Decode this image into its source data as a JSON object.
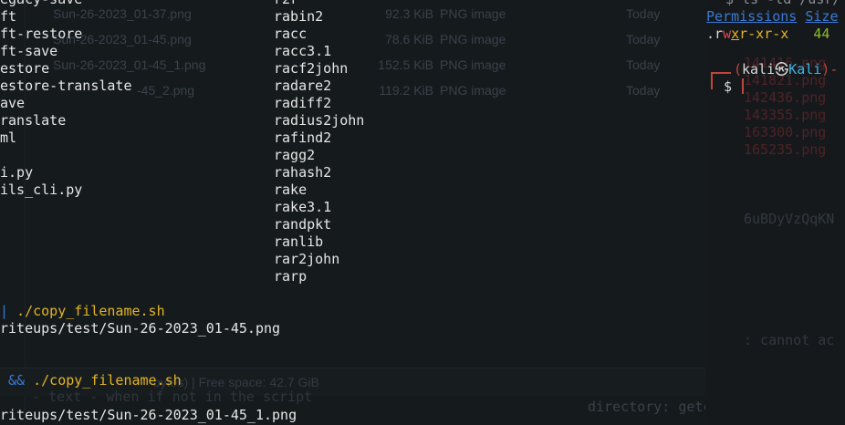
{
  "file_manager": {
    "rows": [
      {
        "name": "Sun-26-2023_01-37.png",
        "size": "92.3 KiB",
        "type": "PNG image",
        "date": "Today"
      },
      {
        "name": "Sun-26-2023_01-45.png",
        "size": "78.6 KiB",
        "type": "PNG image",
        "date": "Today"
      },
      {
        "name": "Sun-26-2023_01-45_1.png",
        "size": "152.5 KiB",
        "type": "PNG image",
        "date": "Today"
      },
      {
        "name": "-45_2.png",
        "size": "119.2 KiB",
        "type": "PNG image",
        "date": "Today"
      }
    ],
    "status": "bytes) | Free space: 42.7 GiB"
  },
  "left_terminal": {
    "col1": [
      "egacy-save",
      "ft",
      "ft-restore",
      "ft-save",
      "estore",
      "estore-translate",
      "ave",
      "ranslate",
      "ml",
      "",
      "i.py",
      "ils_cli.py"
    ],
    "col2": [
      "r2r",
      "rabin2",
      "racc",
      "racc3.1",
      "racf2john",
      "radare2",
      "radiff2",
      "radius2john",
      "rafind2",
      "ragg2",
      "rahash2",
      "rake",
      "rake3.1",
      "randpkt",
      "ranlib",
      "rar2john",
      "rarp"
    ],
    "cmd1_pipe": "| ",
    "cmd1_script": "./copy_filename.sh",
    "out1": "riteups/test/Sun-26-2023_01-45.png",
    "cmd2_and": " && ",
    "cmd2_script": "./copy_filename.sh",
    "out2": "riteups/test/Sun-26-2023_01-45_1.png",
    "ghost_hint": "   - text - when if not in the script",
    "ghost_cmd": "directory: getcwd: cannot ac"
  },
  "right_terminal": {
    "top_cmd": "$ ls -ld /usr/",
    "header_permissions": "Permissions",
    "header_size": "Size",
    "perm_prefix": ".r",
    "perm_w": "w",
    "perm_x": "x",
    "perm_rest": "r-xr-x",
    "size_value": "44",
    "prompt_user": "kali",
    "prompt_symbol": "㉿",
    "prompt_host": "Kali",
    "prompt_dollar": "$",
    "ghost_lines": [
      "141416.png",
      "141821.png",
      "142436.png",
      "143355.png",
      "163300.png",
      "165235.png"
    ],
    "ghost_token": "6uBDyVzQqKN",
    "ghost_error": ": cannot ac"
  },
  "colors": {
    "background": "#151a1d",
    "prompt_red": "#c0453a",
    "accent_blue": "#3a7ad5",
    "accent_yellow": "#e4b424"
  }
}
